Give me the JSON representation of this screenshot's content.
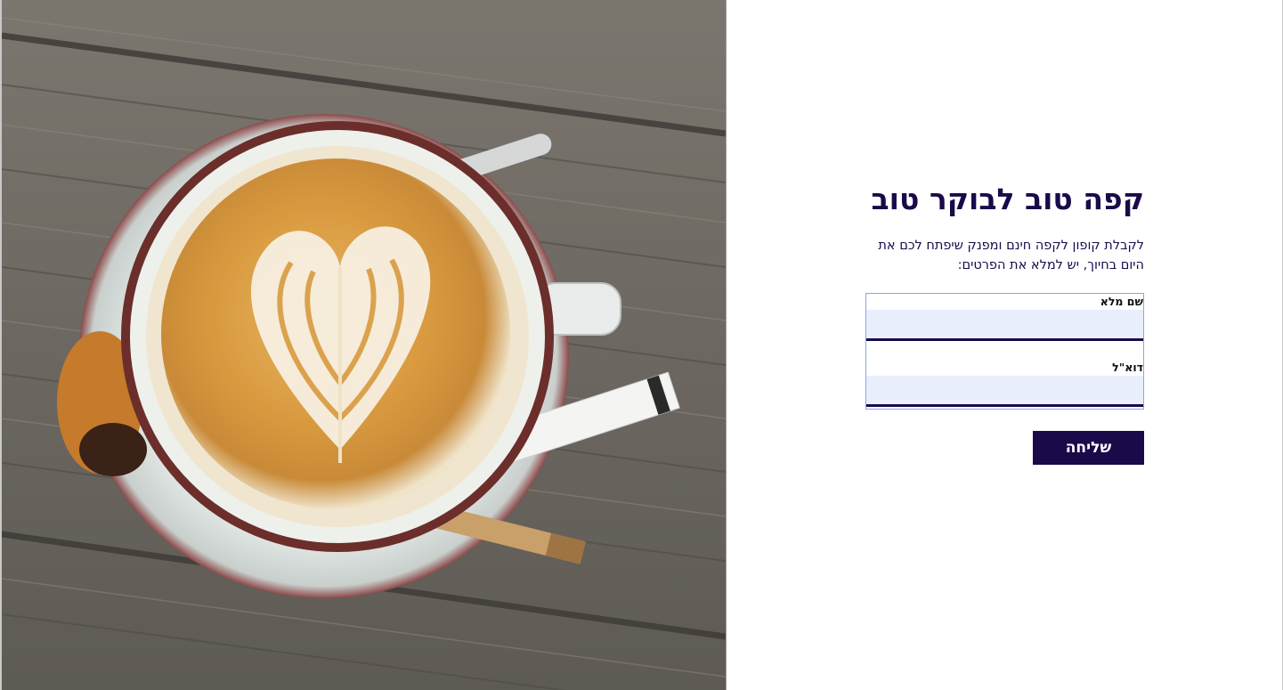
{
  "photo": {
    "subject": "cappuccino-latte-art-photo"
  },
  "form": {
    "title": "קפה טוב לבוקר טוב",
    "description": "לקבלת קופון לקפה חינם ומפנק שיפתח לכם את היום בחיוך, יש למלא את הפרטים:",
    "fields": {
      "name": {
        "label": "שם מלא",
        "value": "",
        "placeholder": ""
      },
      "email": {
        "label": "דוא\"ל",
        "value": "",
        "placeholder": ""
      }
    },
    "submit_label": "שליחה"
  },
  "colors": {
    "brand": "#1a0a4a",
    "field_background": "#e8eefb",
    "focus_outline": "#86a6ee"
  }
}
